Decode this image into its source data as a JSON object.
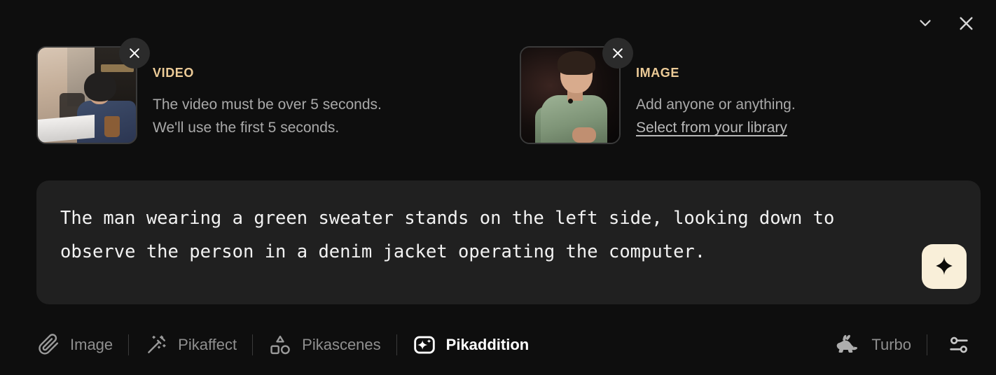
{
  "window": {
    "collapse_icon": "chevron-down-icon",
    "close_icon": "close-icon"
  },
  "attachments": [
    {
      "kicker": "VIDEO",
      "description_line1": "The video must be over 5 seconds.",
      "description_line2": "We'll use the first 5 seconds.",
      "remove_icon": "close-icon",
      "thumbnail_alt": "person in denim jacket at a desk"
    },
    {
      "kicker": "IMAGE",
      "description_line1": "Add anyone or anything.",
      "link_label": "Select from your library",
      "remove_icon": "close-icon",
      "thumbnail_alt": "man in green sweater speaking"
    }
  ],
  "prompt": {
    "value": "The man wearing a green sweater stands on the left side, looking down to observe the person in a denim jacket operating the computer.",
    "placeholder": "",
    "generate_icon": "sparkle-icon"
  },
  "toolbar": {
    "items": [
      {
        "label": "Image",
        "icon": "paperclip-icon",
        "active": false
      },
      {
        "label": "Pikaffect",
        "icon": "magic-wand-icon",
        "active": false
      },
      {
        "label": "Pikascenes",
        "icon": "shapes-icon",
        "active": false
      },
      {
        "label": "Pikaddition",
        "icon": "sparkle-frame-icon",
        "active": true
      }
    ],
    "speed": {
      "label": "Turbo",
      "icon": "rabbit-icon"
    },
    "settings": {
      "icon": "sliders-icon"
    }
  },
  "colors": {
    "background": "#0e0e0e",
    "prompt_background": "#202020",
    "kicker": "#eccb97",
    "generate_button": "#f9efd9",
    "muted_text": "#8f8f8f",
    "active_text": "#ffffff"
  }
}
